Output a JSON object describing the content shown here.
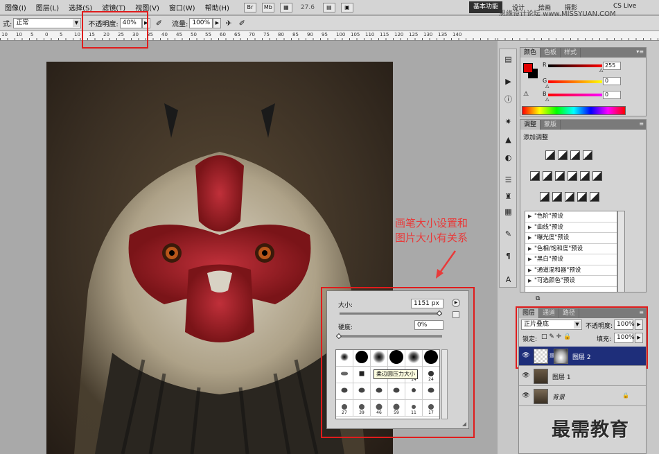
{
  "menubar": {
    "items": [
      "图像(I)",
      "图层(L)",
      "选择(S)",
      "滤镜(T)",
      "视图(V)",
      "窗口(W)",
      "帮助(H)"
    ],
    "zoom": "27.6",
    "workspace_active": "基本功能",
    "workspace_items": [
      "设计",
      "绘画",
      "摄影"
    ],
    "cs_live": "CS Live",
    "site_mark": "思缘设计论坛 www.MISSYUAN.COM"
  },
  "options": {
    "mode_label": "式:",
    "mode_value": "正常",
    "opacity_label": "不透明度:",
    "opacity_value": "40%",
    "flow_label": "流量:",
    "flow_value": "100%"
  },
  "rulers": {
    "top_ticks": [
      "10",
      "10",
      "5",
      "0",
      "5",
      "10",
      "15",
      "20",
      "25",
      "30",
      "35",
      "40",
      "45",
      "50",
      "55",
      "60",
      "65",
      "70",
      "75",
      "80",
      "85",
      "90",
      "95",
      "100",
      "105",
      "110",
      "115",
      "120",
      "125",
      "130",
      "135",
      "140"
    ]
  },
  "annotation": {
    "line1": "画笔大小设置和",
    "line2": "图片大小有关系"
  },
  "brush_panel": {
    "size_label": "大小:",
    "size_value": "1151 px",
    "hardness_label": "硬度:",
    "hardness_value": "0%",
    "size_slider_fraction": 0.98,
    "hardness_slider_fraction": 0.0,
    "tooltip": "柔边圆压力大小",
    "preset_numbers": [
      "14",
      "24",
      "27",
      "39",
      "46",
      "59",
      "11",
      "17"
    ]
  },
  "color_panel": {
    "tabs": [
      "颜色",
      "色板",
      "样式"
    ],
    "r_label": "R",
    "g_label": "G",
    "b_label": "B",
    "r_value": "255",
    "g_value": "0",
    "b_value": "0",
    "foreground_color": "#e00000",
    "r_fraction": 1.0,
    "g_fraction": 0.0,
    "b_fraction": 0.0
  },
  "adjust_panel": {
    "tabs": [
      "调整",
      "蒙版"
    ],
    "title": "添加调整",
    "presets": [
      "\"色阶\"预设",
      "\"曲线\"预设",
      "\"曝光度\"预设",
      "\"色相/饱和度\"预设",
      "\"黑白\"预设",
      "\"通道混和器\"预设",
      "\"可选颜色\"预设"
    ]
  },
  "layers_panel": {
    "tabs": [
      "图层",
      "通道",
      "路径"
    ],
    "blend_value": "正片叠底",
    "opacity_label": "不透明度:",
    "opacity_value": "100%",
    "lock_label": "锁定:",
    "fill_label": "填充:",
    "fill_value": "100%",
    "layers": [
      {
        "name": "图层 2",
        "selected": true
      },
      {
        "name": "图层 1",
        "selected": false
      },
      {
        "name": "背景",
        "selected": false
      }
    ]
  },
  "watermark": "最需教育"
}
